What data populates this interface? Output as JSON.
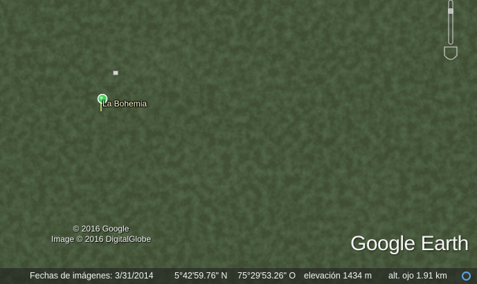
{
  "map": {
    "imagery": "satellite",
    "terrain_color": "#3b4a30"
  },
  "placemark": {
    "label": "La Bohemia",
    "icon": "green-pushpin-icon",
    "color": "#3fd25a"
  },
  "copyright": {
    "line1": "© 2016 Google",
    "line2": "Image © 2016 DigitalGlobe"
  },
  "logo": {
    "text": "Google Earth"
  },
  "status_bar": {
    "imagery_date": "Fechas de imágenes: 3/31/2014",
    "latitude": "5°42'59.76\" N",
    "longitude": "75°29'53.26\" O",
    "elevation": "elevación  1434 m",
    "eye_altitude": "alt. ojo   1.91 km"
  },
  "navigation": {
    "icon": "zoom-slider-icon"
  },
  "streaming": {
    "icon": "streaming-ring-icon",
    "color": "#5aa0e0"
  }
}
